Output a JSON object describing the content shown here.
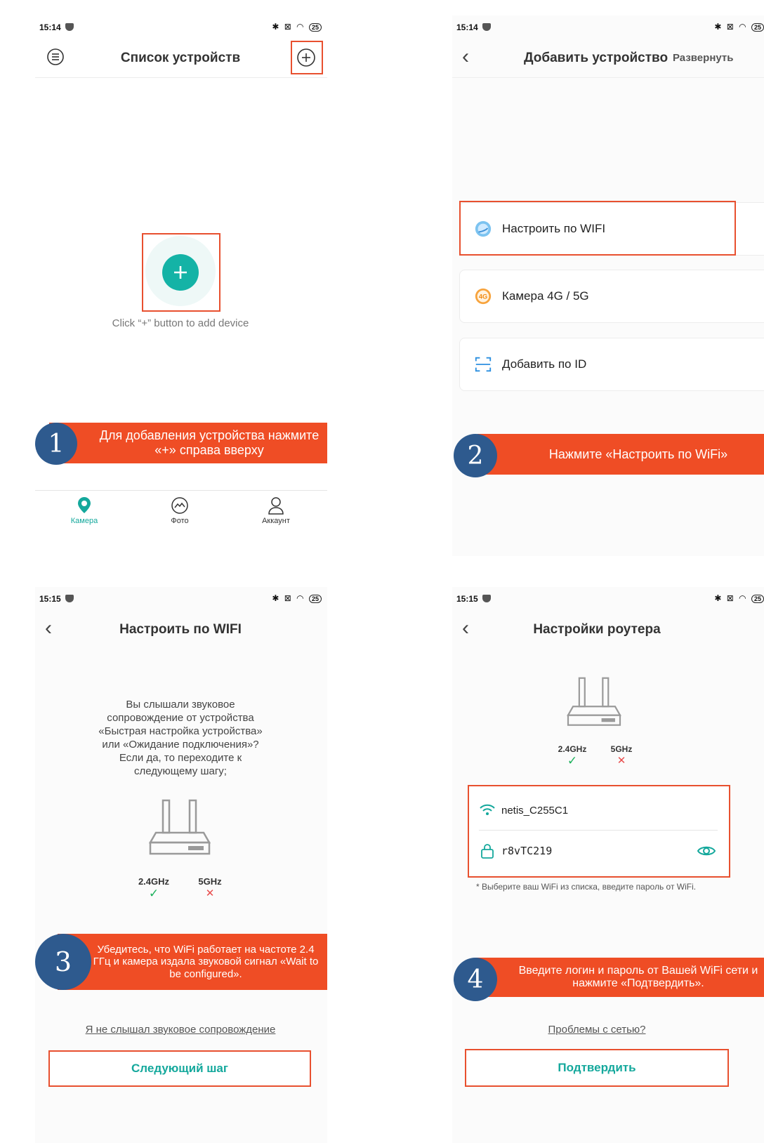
{
  "colors": {
    "accent": "#14a89c",
    "banner": "#ef4d25",
    "badge": "#2e5a8e",
    "highlight": "#e8502f"
  },
  "screen1": {
    "time": "15:14",
    "battery": "25",
    "title": "Список устройств",
    "hint": "Click “+” button to add device",
    "step_number": "1",
    "step_text": "Для добавления устройства нажмите «+» справа вверху",
    "tabs": [
      {
        "label": "Камера",
        "icon": "camera-pin-icon",
        "active": true
      },
      {
        "label": "Фото",
        "icon": "photo-icon",
        "active": false
      },
      {
        "label": "Аккаунт",
        "icon": "user-icon",
        "active": false
      }
    ]
  },
  "screen2": {
    "time": "15:14",
    "battery": "25",
    "title": "Добавить устройство",
    "expand_label": "Развернуть",
    "options": [
      {
        "label": "Настроить по WIFI",
        "icon": "wifi-bubble-icon"
      },
      {
        "label": "Камера 4G / 5G",
        "icon": "4g-icon",
        "icon_text": "4G"
      },
      {
        "label": "Добавить по ID",
        "icon": "scan-icon"
      }
    ],
    "step_number": "2",
    "step_text": "Нажмите «Настроить по WiFi»"
  },
  "screen3": {
    "time": "15:15",
    "battery": "25",
    "title": "Настроить по WIFI",
    "description_lines": [
      "Вы слышали звуковое",
      "сопровождение от устройства",
      "«Быстрая настройка устройства»",
      "или «Ожидание подключения»?",
      "Если да, то переходите к",
      "следующему шагу;"
    ],
    "freq_24": "2.4GHz",
    "freq_5": "5GHz",
    "step_number": "3",
    "step_text": "Убедитесь, что WiFi работает на частоте 2.4 ГГц и камера издала звуковой сигнал «Wait to be configured».",
    "link": "Я не слышал звуковое сопровождение",
    "button": "Следующий шаг"
  },
  "screen4": {
    "time": "15:15",
    "battery": "25",
    "title": "Настройки роутера",
    "freq_24": "2.4GHz",
    "freq_5": "5GHz",
    "ssid": "netis_C255C1",
    "password": "r8vTC219",
    "note": "* Выберите ваш WiFi из списка, введите пароль от WiFi.",
    "step_number": "4",
    "step_text": "Введите логин и пароль от Вашей WiFi сети и нажмите «Подтвердить».",
    "link": "Проблемы с сетью?",
    "button": "Подтвердить"
  }
}
